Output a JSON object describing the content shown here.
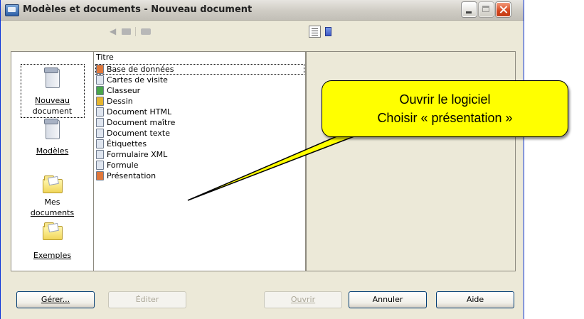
{
  "window": {
    "title": "Modèles et documents - Nouveau document"
  },
  "toolbar": {
    "back_icon": "back-arrow-icon",
    "up_icon": "folder-up-icon",
    "print_icon": "print-icon",
    "view_list_icon": "list-view-icon",
    "view_preview_icon": "document-preview-icon"
  },
  "sidebar": {
    "items": [
      {
        "label_line1": "Nouveau",
        "label_line2": "document",
        "selected": true,
        "icon": "new-document-icon"
      },
      {
        "label_line1": "Modèles",
        "label_line2": "",
        "selected": false,
        "icon": "templates-icon"
      },
      {
        "label_line1": "Mes",
        "label_line2": "documents",
        "selected": false,
        "icon": "my-documents-folder-icon"
      },
      {
        "label_line1": "Exemples",
        "label_line2": "",
        "selected": false,
        "icon": "examples-folder-icon"
      }
    ]
  },
  "file_list": {
    "header": "Titre",
    "items": [
      {
        "label": "Base de données",
        "icon_color": "#e0773a"
      },
      {
        "label": "Cartes de visite",
        "icon_color": "#dfe5ef"
      },
      {
        "label": "Classeur",
        "icon_color": "#4aa64a"
      },
      {
        "label": "Dessin",
        "icon_color": "#e5b530"
      },
      {
        "label": "Document HTML",
        "icon_color": "#dfe5ef"
      },
      {
        "label": "Document maître",
        "icon_color": "#dfe5ef"
      },
      {
        "label": "Document texte",
        "icon_color": "#dfe5ef"
      },
      {
        "label": "Étiquettes",
        "icon_color": "#dfe5ef"
      },
      {
        "label": "Formulaire XML",
        "icon_color": "#dfe5ef"
      },
      {
        "label": "Formule",
        "icon_color": "#dfe5ef"
      },
      {
        "label": "Présentation",
        "icon_color": "#e0773a"
      }
    ]
  },
  "buttons": {
    "manage": "Gérer...",
    "edit": "Éditer",
    "open": "Ouvrir",
    "cancel": "Annuler",
    "help": "Aide"
  },
  "callout": {
    "line1": "Ouvrir le logiciel",
    "line2": "Choisir « présentation »",
    "color": "#ffff00"
  }
}
